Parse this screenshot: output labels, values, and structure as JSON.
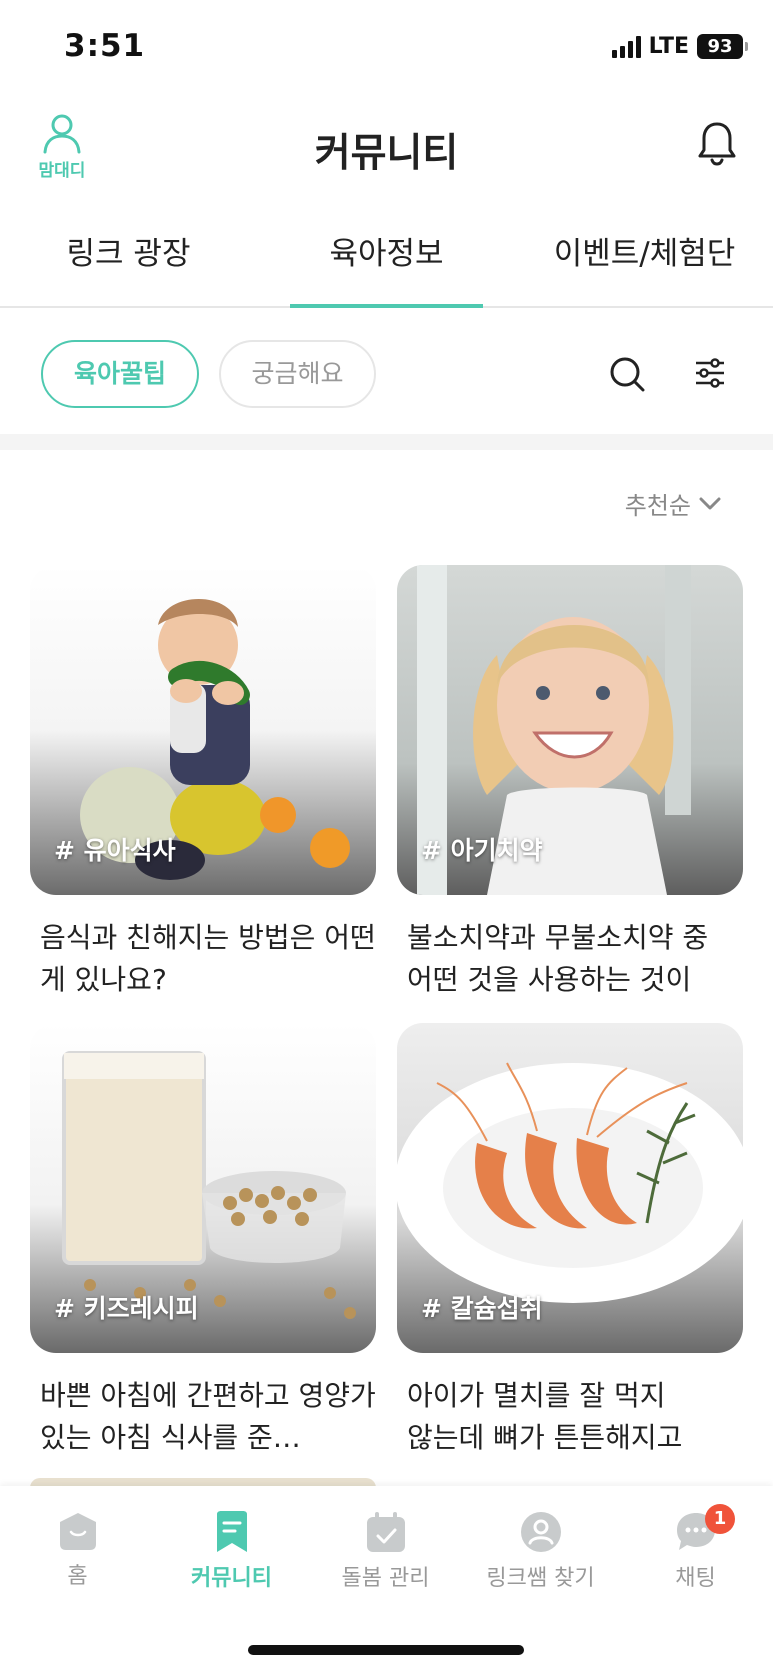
{
  "status_bar": {
    "time": "3:51",
    "network": "LTE",
    "battery": "93"
  },
  "header": {
    "title": "커뮤니티",
    "profile_label": "맘대디"
  },
  "tabs": [
    {
      "label": "링크 광장",
      "active": false
    },
    {
      "label": "육아정보",
      "active": true
    },
    {
      "label": "이벤트/체험단",
      "active": false
    }
  ],
  "filters": [
    {
      "label": "육아꿀팁",
      "selected": true
    },
    {
      "label": "궁금해요",
      "selected": false
    }
  ],
  "sort": {
    "label": "추천순"
  },
  "posts": [
    {
      "tag": "# 유아식사",
      "title": "음식과 친해지는 방법은 어떤 게 있나요?",
      "image": "baby-eating-zucchini"
    },
    {
      "tag": "# 아기치약",
      "title": "불소치약과 무불소치약 중 어떤 것을 사용하는 것이",
      "image": "smiling-girl-toothbrush"
    },
    {
      "tag": "# 키즈레시피",
      "title": "바쁜 아침에 간편하고 영양가 있는 아침 식사를 준…",
      "image": "soy-milk-and-beans"
    },
    {
      "tag": "# 칼슘섭취",
      "title": "아이가 멸치를 잘 먹지 않는데 뼈가 튼튼해지고 성…",
      "image": "shrimp-bowl"
    }
  ],
  "bottom_nav": [
    {
      "label": "홈",
      "icon": "home-icon",
      "active": false
    },
    {
      "label": "커뮤니티",
      "icon": "community-icon",
      "active": true
    },
    {
      "label": "돌봄 관리",
      "icon": "calendar-check-icon",
      "active": false
    },
    {
      "label": "링크쌤 찾기",
      "icon": "teacher-search-icon",
      "active": false
    },
    {
      "label": "채팅",
      "icon": "chat-icon",
      "active": false,
      "badge": "1"
    }
  ],
  "colors": {
    "accent": "#4ec9b0",
    "badge": "#f0533a",
    "inactive": "#999999"
  }
}
